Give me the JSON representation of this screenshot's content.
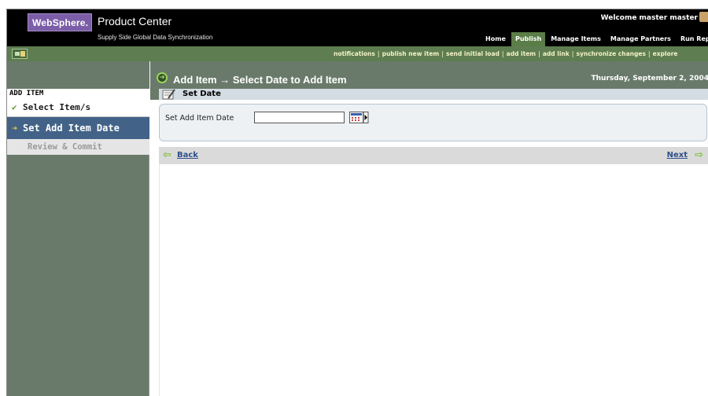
{
  "header": {
    "logo": "WebSphere.",
    "product_title": "Product Center",
    "product_subtitle": "Supply Side Global Data Synchronization",
    "welcome": "Welcome  master master",
    "tabs": [
      {
        "label": "Home",
        "active": false
      },
      {
        "label": "Publish",
        "active": true
      },
      {
        "label": "Manage Items",
        "active": false
      },
      {
        "label": "Manage Partners",
        "active": false
      },
      {
        "label": "Run Report",
        "active": false
      }
    ]
  },
  "actionbar": {
    "links": [
      "notifications",
      "publish new item",
      "send initial load",
      "add item",
      "add link",
      "synchronize changes",
      "explore"
    ]
  },
  "sidebar": {
    "section_title": "ADD ITEM",
    "steps": [
      {
        "label": "Select Item/s",
        "state": "done"
      },
      {
        "label": "Set Add Item Date",
        "state": "current"
      },
      {
        "label": "Review & Commit",
        "state": "pending"
      }
    ]
  },
  "main": {
    "title": "Add Item → Select Date to Add Item",
    "date": "Thursday, September 2, 2004",
    "section_title": "Set Date",
    "field_label": "Set Add Item Date",
    "field_value": "",
    "back_label": "Back",
    "next_label": "Next"
  },
  "colors": {
    "header_bg": "#000000",
    "active_tab": "#5b7d47",
    "actionbar_bg": "#5e7d50",
    "sidebar_bg": "#697a6a",
    "current_step": "#426387",
    "link": "#2d4f8a"
  }
}
